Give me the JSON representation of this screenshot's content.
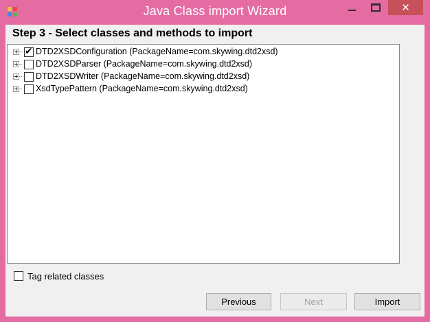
{
  "window": {
    "title": "Java Class import Wizard",
    "close_glyph": "✕"
  },
  "step_title": "Step 3 - Select classes and methods to import",
  "tree": {
    "items": [
      {
        "label": "DTD2XSDConfiguration (PackageName=com.skywing.dtd2xsd)",
        "checked": true,
        "check_glyph": "✔"
      },
      {
        "label": "DTD2XSDParser (PackageName=com.skywing.dtd2xsd)",
        "checked": false,
        "check_glyph": ""
      },
      {
        "label": "DTD2XSDWriter (PackageName=com.skywing.dtd2xsd)",
        "checked": false,
        "check_glyph": ""
      },
      {
        "label": "XsdTypePattern (PackageName=com.skywing.dtd2xsd)",
        "checked": false,
        "check_glyph": ""
      }
    ]
  },
  "tag_related": {
    "label": "Tag related classes",
    "checked": false
  },
  "buttons": {
    "previous": "Previous",
    "next": "Next",
    "import": "Import"
  }
}
